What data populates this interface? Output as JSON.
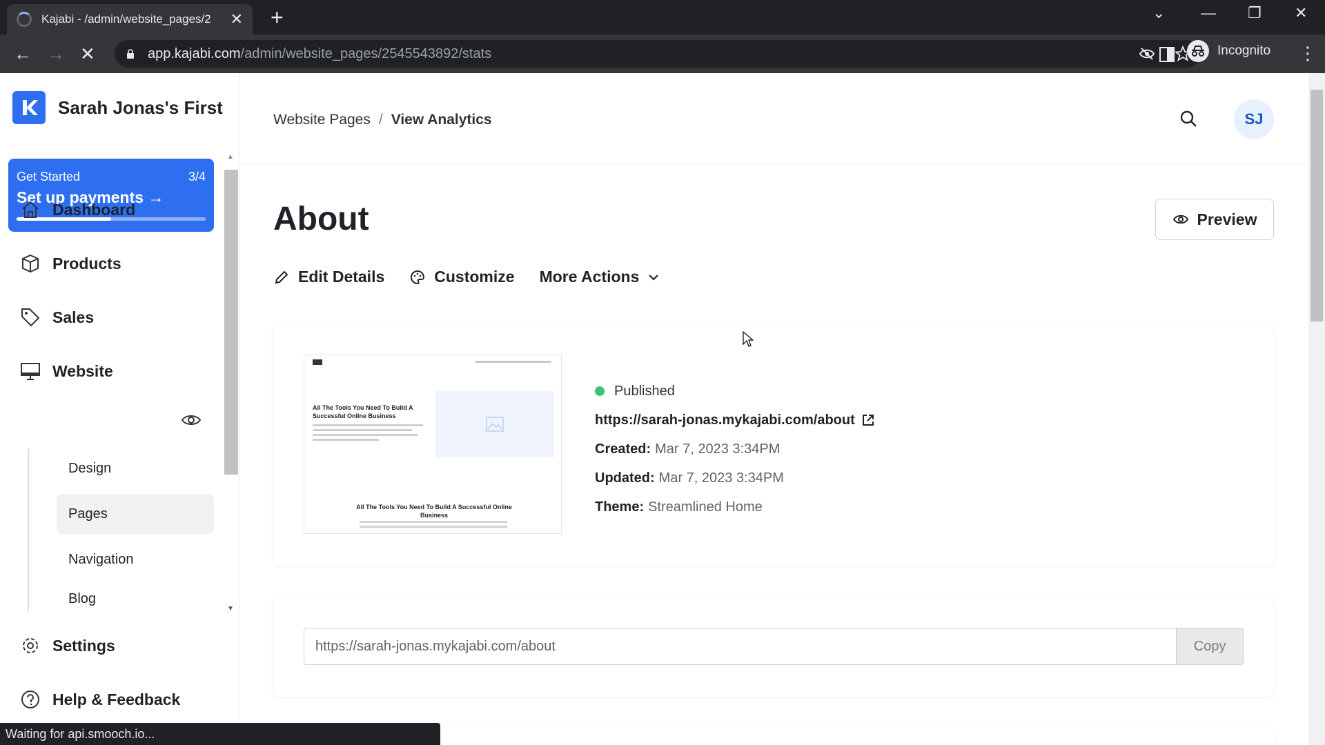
{
  "browser": {
    "tab_title": "Kajabi - /admin/website_pages/2",
    "url_domain": "app.kajabi.com",
    "url_path": "/admin/website_pages/2545543892/stats",
    "profile": "Incognito",
    "status": "Waiting for api.smooch.io..."
  },
  "sidebar": {
    "site_name": "Sarah Jonas's First",
    "get_started": {
      "label": "Get Started",
      "progress": "3/4",
      "progress_fraction": 0.5,
      "task": "Set up payments"
    },
    "items": [
      {
        "label": "Dashboard",
        "icon": "home-icon"
      },
      {
        "label": "Products",
        "icon": "box-icon"
      },
      {
        "label": "Sales",
        "icon": "tag-icon"
      },
      {
        "label": "Website",
        "icon": "monitor-icon"
      }
    ],
    "website_sub": [
      {
        "label": "Design"
      },
      {
        "label": "Pages",
        "active": true
      },
      {
        "label": "Navigation"
      },
      {
        "label": "Blog"
      }
    ],
    "settings": "Settings",
    "help": "Help & Feedback"
  },
  "header": {
    "breadcrumb_parent": "Website Pages",
    "breadcrumb_sep": "/",
    "breadcrumb_current": "View Analytics",
    "avatar": "SJ"
  },
  "page": {
    "title": "About",
    "preview": "Preview",
    "actions": {
      "edit": "Edit Details",
      "customize": "Customize",
      "more": "More Actions"
    }
  },
  "details": {
    "thumbnail": {
      "headline": "All The Tools You Need To Build A Successful Online Business",
      "headline2": "All The Tools You Need To Build A Successful Online Business"
    },
    "status": "Published",
    "status_color": "#3ec46d",
    "url": "https://sarah-jonas.mykajabi.com/about",
    "created_label": "Created:",
    "created": "Mar 7, 2023 3:34PM",
    "updated_label": "Updated:",
    "updated": "Mar 7, 2023 3:34PM",
    "theme_label": "Theme:",
    "theme": "Streamlined Home"
  },
  "share": {
    "url": "https://sarah-jonas.mykajabi.com/about",
    "copy": "Copy"
  },
  "colors": {
    "brand": "#2e6ff2"
  }
}
